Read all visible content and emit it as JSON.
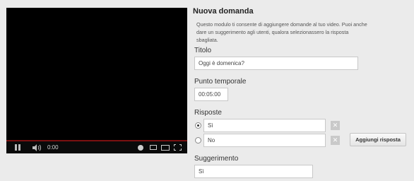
{
  "player": {
    "time": "0:00",
    "progress_fraction": 0,
    "colors": {
      "background": "#000000",
      "progress_played": "#d01c1c",
      "progress_track": "#7a1010"
    },
    "icons": [
      "pause-icon",
      "volume-icon",
      "info-icon",
      "small-player-icon",
      "large-player-icon",
      "fullscreen-icon"
    ]
  },
  "form": {
    "title": "Nuova domanda",
    "description": "Questo modulo ti consente di aggiungere domande al tuo video. Puoi anche dare un suggerimento agli utenti, qualora selezionassero la risposta sbagliata.",
    "title_label": "Titolo",
    "title_value": "Oggi è domenica?",
    "time_label": "Punto temporale",
    "time_value": "00:05:00",
    "answers_label": "Risposte",
    "answers": [
      {
        "value": "Sì",
        "checked": true,
        "remove_label": "✕"
      },
      {
        "value": "No",
        "checked": false,
        "remove_label": "✕"
      }
    ],
    "add_answer_label": "Aggiungi risposta",
    "hint_label": "Suggerimento",
    "hint_value": "Sì"
  }
}
